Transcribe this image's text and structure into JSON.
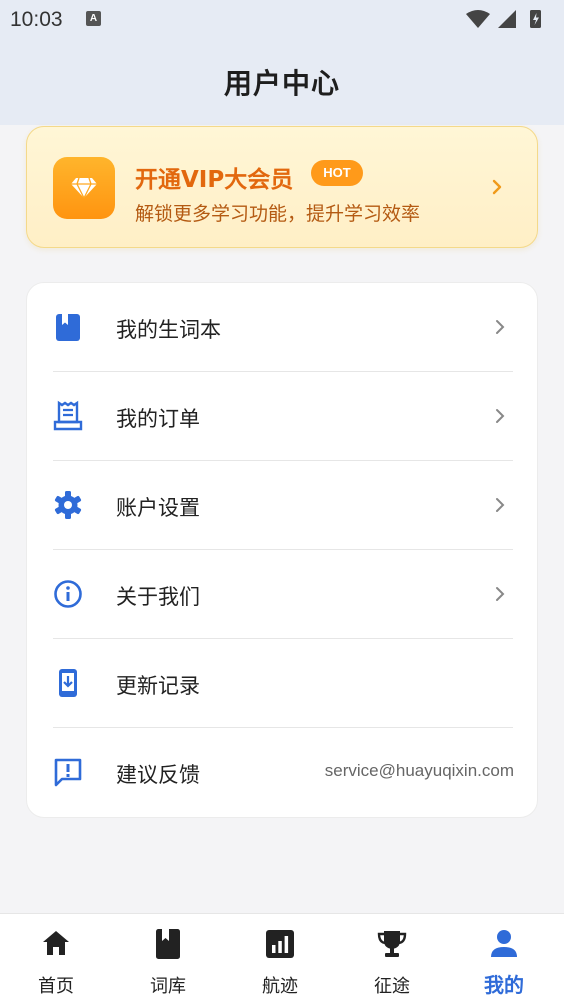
{
  "status_bar": {
    "time": "10:03",
    "notification_icon": "a-icon",
    "icons": [
      "wifi-icon",
      "signal-icon",
      "battery-icon"
    ]
  },
  "header": {
    "title": "用户中心"
  },
  "vip_banner": {
    "title": "开通VIP大会员",
    "badge": "HOT",
    "subtitle": "解锁更多学习功能，提升学习效率",
    "icon": "diamond-icon"
  },
  "menu": {
    "items": [
      {
        "label": "我的生词本",
        "icon": "book-icon",
        "extra": ""
      },
      {
        "label": "我的订单",
        "icon": "receipt-icon",
        "extra": ""
      },
      {
        "label": "账户设置",
        "icon": "gear-icon",
        "extra": ""
      },
      {
        "label": "关于我们",
        "icon": "info-icon",
        "extra": ""
      },
      {
        "label": "更新记录",
        "icon": "download-icon",
        "extra": ""
      },
      {
        "label": "建议反馈",
        "icon": "feedback-icon",
        "extra": "service@huayuqixin.com"
      }
    ]
  },
  "bottom_nav": {
    "items": [
      {
        "label": "首页",
        "icon": "home-icon"
      },
      {
        "label": "词库",
        "icon": "bookmark-icon"
      },
      {
        "label": "航迹",
        "icon": "chart-icon"
      },
      {
        "label": "征途",
        "icon": "trophy-icon"
      },
      {
        "label": "我的",
        "icon": "person-icon",
        "active": true
      }
    ]
  },
  "colors": {
    "accent": "#2f6bd8",
    "vip_orange": "#e2680e",
    "header_bg": "#e6ebf4"
  }
}
